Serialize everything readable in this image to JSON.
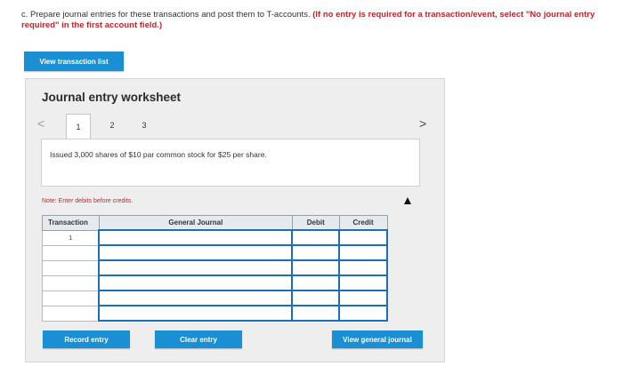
{
  "instructions": {
    "part1": "c. Prepare journal entries for these transactions and post them to T-accounts.",
    "part2": "(If no entry is required for a transaction/event, select \"No journal entry required\" in the first account field.)"
  },
  "buttons": {
    "view_transaction_list": "View transaction list",
    "record_entry": "Record entry",
    "clear_entry": "Clear entry",
    "view_general_journal": "View general journal"
  },
  "worksheet": {
    "title": "Journal entry worksheet",
    "nav_prev": "<",
    "nav_next": ">",
    "tabs": [
      "1",
      "2",
      "3"
    ],
    "description": "Issued 3,000 shares of $10 par common stock for $25 per share.",
    "note": "Note: Enter debits before credits."
  },
  "journal_table": {
    "headers": [
      "Transaction",
      "General Journal",
      "Debit",
      "Credit"
    ],
    "rows": [
      {
        "transaction": "1",
        "account": "",
        "debit": "",
        "credit": ""
      },
      {
        "transaction": "",
        "account": "",
        "debit": "",
        "credit": ""
      },
      {
        "transaction": "",
        "account": "",
        "debit": "",
        "credit": ""
      },
      {
        "transaction": "",
        "account": "",
        "debit": "",
        "credit": ""
      },
      {
        "transaction": "",
        "account": "",
        "debit": "",
        "credit": ""
      },
      {
        "transaction": "",
        "account": "",
        "debit": "",
        "credit": ""
      }
    ]
  },
  "colors": {
    "button_blue": "#1a8fd3",
    "instruction_red": "#c0272d",
    "field_border": "#1a6fb8"
  }
}
